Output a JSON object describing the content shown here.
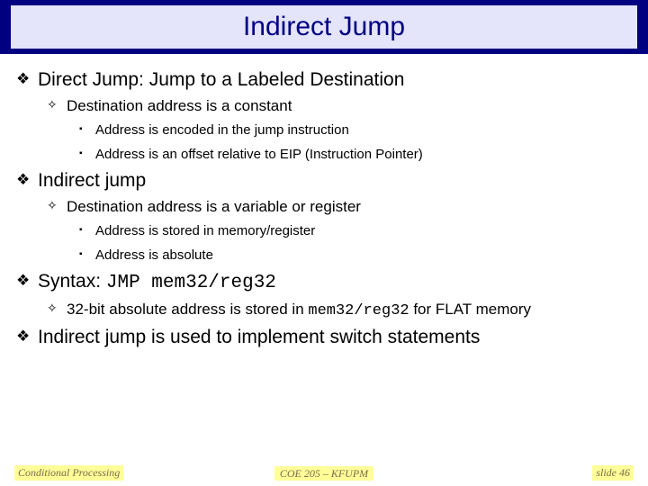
{
  "title": "Indirect Jump",
  "body": {
    "p1": "Direct Jump: Jump to a Labeled Destination",
    "p1a": "Destination address is a constant",
    "p1a1": "Address is encoded in the jump instruction",
    "p1a2": "Address is an offset relative to EIP (Instruction Pointer)",
    "p2": "Indirect jump",
    "p2a": "Destination address is a variable or register",
    "p2a1": "Address is stored in memory/register",
    "p2a2": "Address is absolute",
    "p3_prefix": "Syntax: ",
    "p3_code": "JMP mem32/reg32",
    "p3a_prefix": "32-bit absolute address is stored in ",
    "p3a_code": "mem32/reg32",
    "p3a_suffix": "  for FLAT memory",
    "p4": "Indirect jump is used to implement switch statements"
  },
  "footer": {
    "left": "Conditional Processing",
    "center": "COE 205 – KFUPM",
    "right": "slide 46"
  }
}
